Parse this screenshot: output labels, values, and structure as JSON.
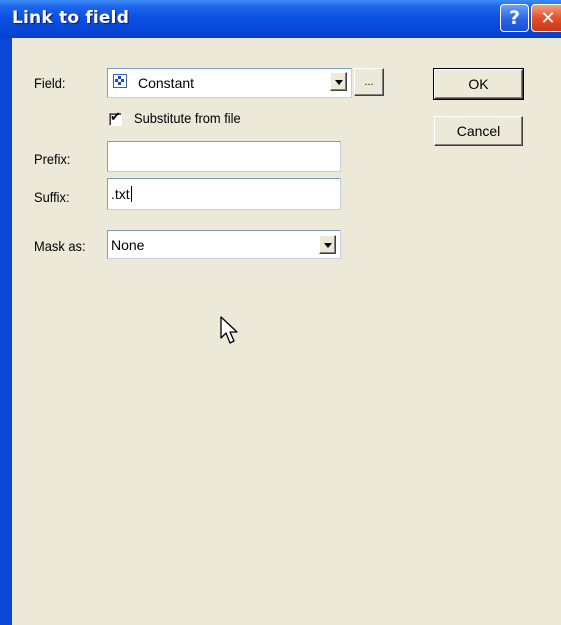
{
  "window": {
    "title": "Link to field",
    "help_glyph": "?",
    "close_glyph": "✕"
  },
  "form": {
    "field_label": "Field:",
    "field_value": "Constant",
    "field_icon": "constant-icon",
    "browse_label": "...",
    "substitute_label": "Substitute from file",
    "substitute_checked": true,
    "check_glyph": "✔",
    "prefix_label": "Prefix:",
    "prefix_value": "",
    "suffix_label": "Suffix:",
    "suffix_value": ".txt",
    "mask_label": "Mask as:",
    "mask_value": "None"
  },
  "buttons": {
    "ok": "OK",
    "cancel": "Cancel"
  },
  "colors": {
    "titlebar": "#0a4fe0",
    "dialog_bg": "#ece9d8",
    "field_border": "#7f9db9"
  }
}
